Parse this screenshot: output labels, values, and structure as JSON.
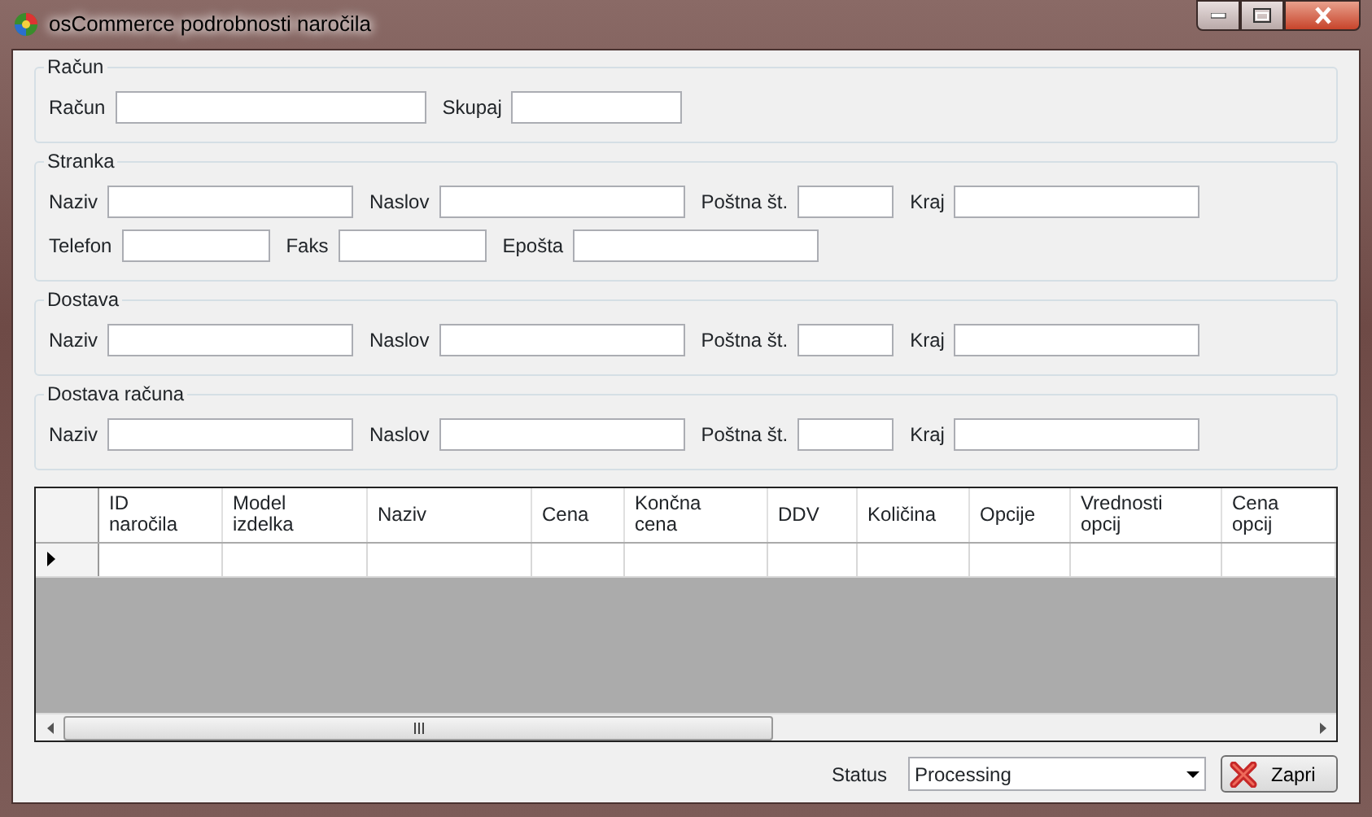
{
  "window": {
    "title": "osCommerce podrobnosti naročila"
  },
  "groups": [
    {
      "title": "Račun",
      "rows": [
        [
          {
            "label": "Račun"
          },
          {
            "label": "Skupaj"
          }
        ]
      ]
    },
    {
      "title": "Stranka",
      "rows": [
        [
          {
            "label": "Naziv"
          },
          {
            "label": "Naslov"
          },
          {
            "label": "Poštna št."
          },
          {
            "label": "Kraj"
          }
        ],
        [
          {
            "label": "Telefon"
          },
          {
            "label": "Faks"
          },
          {
            "label": "Epošta"
          }
        ]
      ]
    },
    {
      "title": "Dostava",
      "rows": [
        [
          {
            "label": "Naziv"
          },
          {
            "label": "Naslov"
          },
          {
            "label": "Poštna št."
          },
          {
            "label": "Kraj"
          }
        ]
      ]
    },
    {
      "title": "Dostava računa",
      "rows": [
        [
          {
            "label": "Naziv"
          },
          {
            "label": "Naslov"
          },
          {
            "label": "Poštna št."
          },
          {
            "label": "Kraj"
          }
        ]
      ]
    }
  ],
  "grid": {
    "columns": [
      "ID\nnaročila",
      "Model\nizdelka",
      "Naziv",
      "Cena",
      "Končna\ncena",
      "DDV",
      "Količina",
      "Opcije",
      "Vrednosti\nopcij",
      "Cena\nopcij"
    ],
    "rows": [
      {
        "current": true
      }
    ]
  },
  "status": {
    "label": "Status",
    "value": "Processing"
  },
  "buttons": [
    "Zapri"
  ]
}
